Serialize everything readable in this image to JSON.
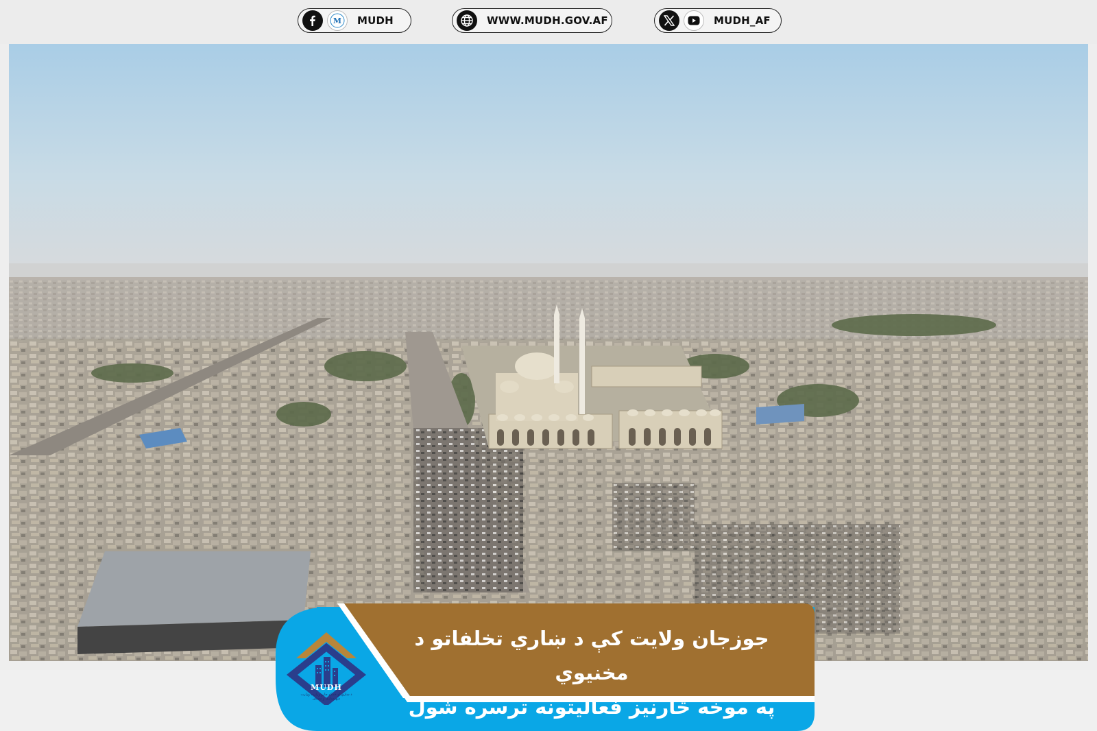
{
  "social": {
    "facebook": {
      "icon": "facebook-icon",
      "logo_icon": "mudh-logo-icon",
      "handle": "MUDH"
    },
    "website": {
      "icon": "globe-icon",
      "url": "WWW.MUDH.GOV.AF"
    },
    "x_youtube": {
      "icon_x": "x-icon",
      "icon_youtube": "youtube-icon",
      "handle": "MUDH_AF"
    }
  },
  "photo": {
    "subject": "aerial-city-photo"
  },
  "banner": {
    "headline_line1": "جوزجان ولایت کې د ښاري تخلفاتو د مخنیوي",
    "headline_line2": "په موخه څارنیز فعالیتونه ترسره شول",
    "logo_text": "MUDH",
    "logo_subtext": "د ښاري او ځمکو چارو وزارت\nوزارت شهرسازی و مسکن",
    "colors": {
      "brown": "#a07030",
      "blue": "#0aa7e6",
      "navy": "#2a3e8c",
      "logo_accent": "#b8863a"
    }
  }
}
